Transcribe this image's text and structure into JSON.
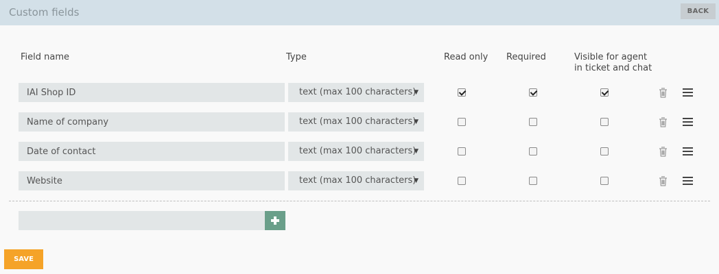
{
  "header": {
    "title": "Custom fields",
    "back_label": "BACK"
  },
  "columns": {
    "field_name": "Field name",
    "type": "Type",
    "read_only": "Read only",
    "required": "Required",
    "visible_line1": "Visible for agent",
    "visible_line2": "in ticket and chat"
  },
  "rows": [
    {
      "name": "IAI Shop ID",
      "type": "text (max 100 characters)",
      "read_only": true,
      "required": true,
      "visible": true
    },
    {
      "name": "Name of company",
      "type": "text (max 100 characters)",
      "read_only": false,
      "required": false,
      "visible": false
    },
    {
      "name": "Date of contact",
      "type": "text (max 100 characters)",
      "read_only": false,
      "required": false,
      "visible": false
    },
    {
      "name": "Website",
      "type": "text (max 100 characters)",
      "read_only": false,
      "required": false,
      "visible": false
    }
  ],
  "new_field": {
    "value": ""
  },
  "icons": {
    "trash": "trash-icon",
    "menu": "menu-icon",
    "add": "plus-icon",
    "caret": "caret-down-icon"
  },
  "colors": {
    "header_bg": "#d3e0e8",
    "accent_save": "#f5a328",
    "accent_add": "#6a9f8a"
  },
  "save_label": "SAVE"
}
